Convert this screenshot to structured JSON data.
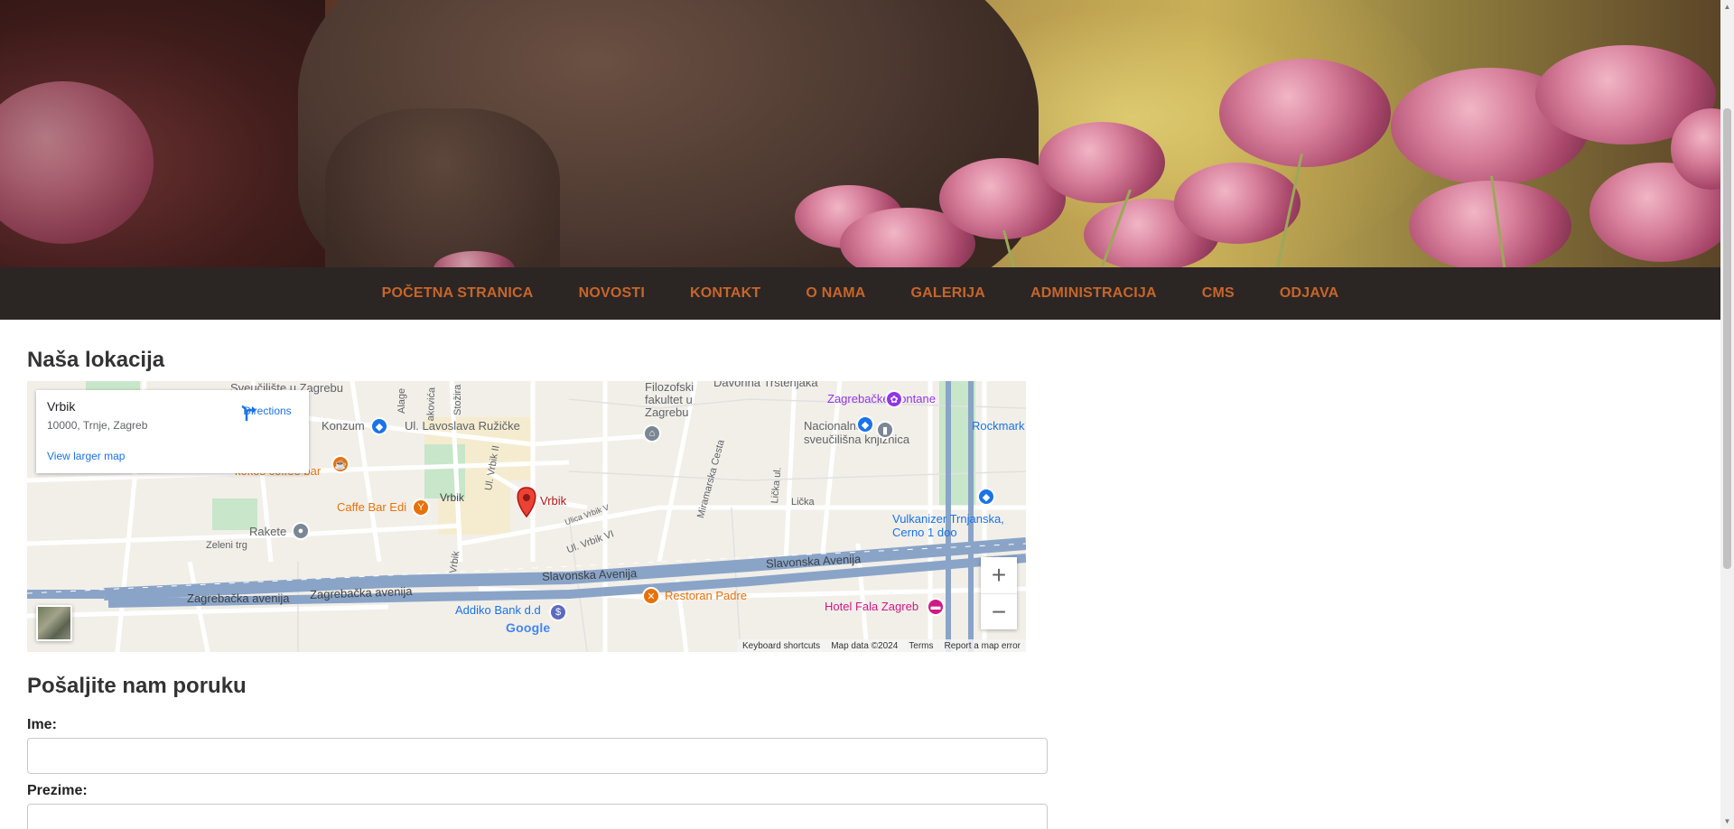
{
  "nav": {
    "items": [
      "POČETNA STRANICA",
      "NOVOSTI",
      "KONTAKT",
      "O NAMA",
      "GALERIJA",
      "ADMINISTRACIJA",
      "CMS",
      "ODJAVA"
    ]
  },
  "location": {
    "title": "Naša lokacija"
  },
  "map": {
    "place_name": "Vrbik",
    "place_address": "10000, Trnje, Zagreb",
    "directions_label": "Directions",
    "view_larger": "View larger map",
    "pin_label": "Vrbik",
    "labels": {
      "sveuciliste": "Sveučilište u Zagrebu",
      "kultet": "kultet",
      "konzum": "Konzum",
      "lavoslava": "Ul. Lavoslava Ružičke",
      "filozofski": "Filozofski fakultet u Zagrebu",
      "davorina": "Davorina Trstenjaka",
      "fontane": "Zagrebačke Fontane",
      "rockmark": "Rockmark",
      "knjiznica": "Nacionalna i sveučilišna knjižnica",
      "miramarska": "Miramarska Cesta",
      "licka_cesta": "Lička ul.",
      "licka": "Lička",
      "vulkanizer": "Vulkanizer Trnjanska, Cerno 1 doo",
      "coffee": "kokoš coffee bar",
      "caffe_edi": "Caffe Bar Edi",
      "vrbik_st": "Vrbik",
      "vrbik2": "Ul. Vrbik II",
      "vrbik5": "Ulica Vrbik V",
      "vrbik6": "Ul. Vrbik VI",
      "vrbik_v": "Vrbik",
      "rakete": "Rakete",
      "zeleni_trg": "Zeleni trg",
      "slavonska1": "Slavonska Avenija",
      "slavonska2": "Slavonska Avenija",
      "zagrebacka1": "Zagrebačka avenija",
      "zagrebacka2": "Zagrebačka avenija",
      "addiko": "Addiko Bank d.d",
      "restoran": "Restoran Padre",
      "hotel": "Hotel Fala Zagreb",
      "ul_alage": "Alage",
      "kakovica": "akovića",
      "stozira": "Stožira"
    },
    "google": "Google",
    "footer": [
      "Keyboard shortcuts",
      "Map data ©2024",
      "Terms",
      "Report a map error"
    ]
  },
  "form": {
    "title": "Pošaljite nam poruku",
    "first_name_label": "Ime:",
    "first_name_value": "",
    "last_name_label": "Prezime:",
    "last_name_value": ""
  },
  "colors": {
    "nav_bg": "#2b2624",
    "nav_text": "#c8652a",
    "highway": "#8aa4c8"
  }
}
